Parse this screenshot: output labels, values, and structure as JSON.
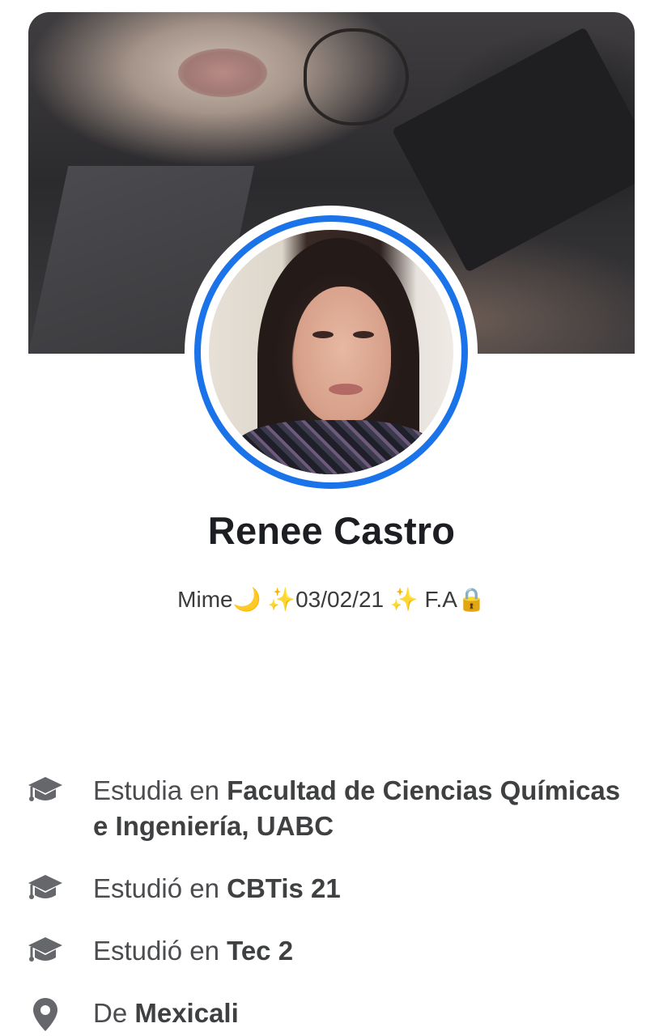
{
  "profile": {
    "name": "Renee Castro",
    "bio": "Mime🌙 ✨03/02/21 ✨ F.A🔒"
  },
  "details": [
    {
      "icon": "graduation-cap-icon",
      "prefix": "Estudia en ",
      "value": "Facultad de Ciencias Químicas e Ingeniería, UABC"
    },
    {
      "icon": "graduation-cap-icon",
      "prefix": "Estudió en ",
      "value": "CBTis 21"
    },
    {
      "icon": "graduation-cap-icon",
      "prefix": "Estudió en ",
      "value": "Tec 2"
    },
    {
      "icon": "location-pin-icon",
      "prefix": "De ",
      "value": "Mexicali"
    }
  ],
  "colors": {
    "accent": "#1a73e8",
    "icon": "#65676b",
    "name": "#1c1e21",
    "detail_text": "#4b4c4f"
  }
}
